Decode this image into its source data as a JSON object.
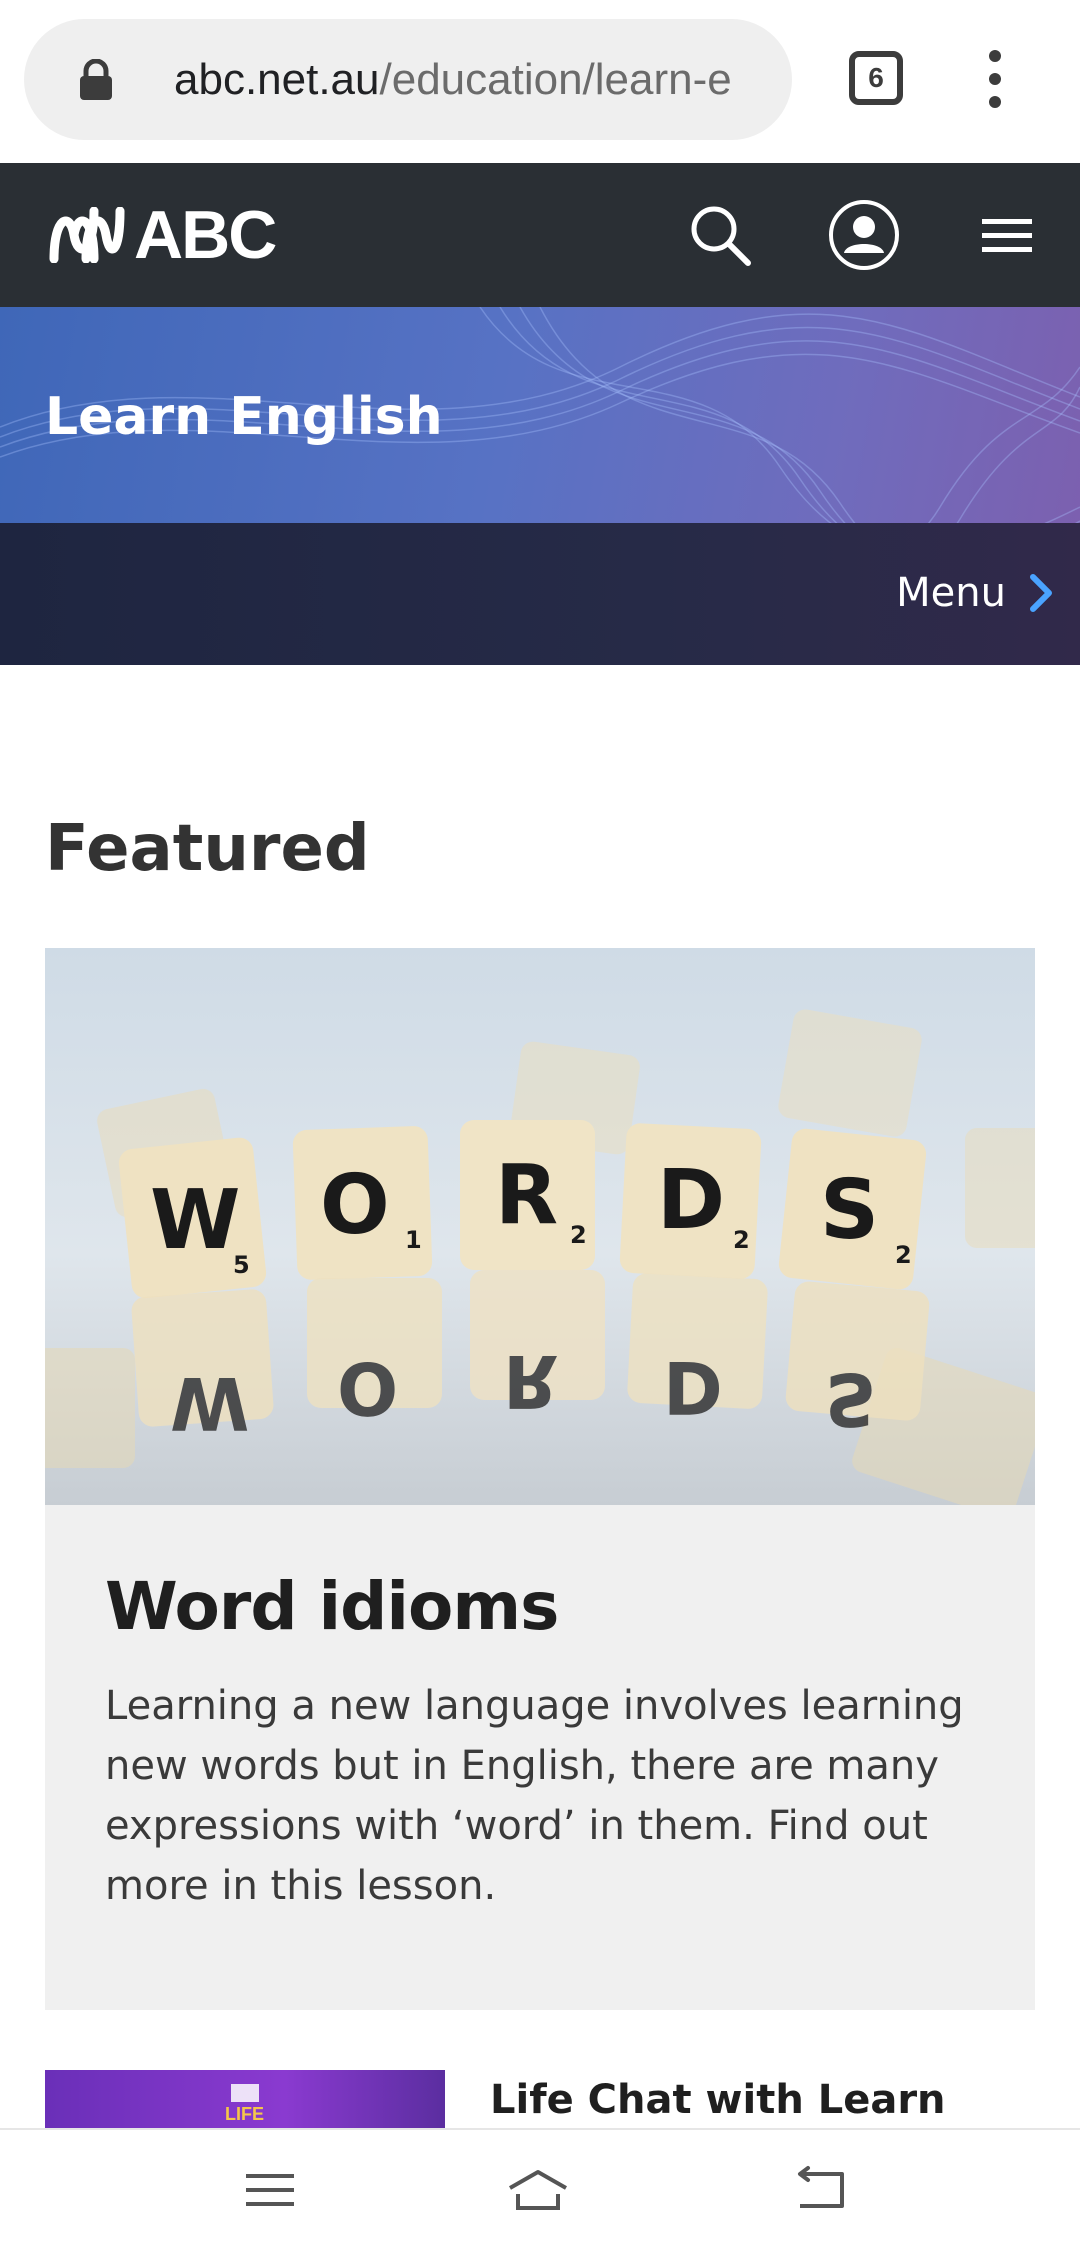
{
  "browser": {
    "url_host": "abc.net.au",
    "url_path": "/education/learn-e",
    "tab_count": "6"
  },
  "header": {
    "logo_text": "ABC"
  },
  "banner": {
    "title": "Learn English",
    "menu_label": "Menu"
  },
  "featured": {
    "heading": "Featured",
    "card": {
      "title": "Word idioms",
      "description": "Learning a new language involves learning new words but in English, there are many expressions with ‘word’ in them. Find out more in this lesson.",
      "image_tiles_top": [
        "W",
        "O",
        "R",
        "D",
        "S"
      ],
      "image_tiles_top_scores": [
        "5",
        "1",
        "2",
        "2",
        "2"
      ]
    }
  },
  "next_item": {
    "title": "Life Chat with Learn",
    "thumb_text": "LIFE"
  },
  "colors": {
    "header_bg": "#2a2f34",
    "banner_start": "#3f67b8",
    "banner_end": "#7d5fae",
    "menu_chevron": "#4aa3ff",
    "card_bg": "#f0f0f0"
  },
  "icons": {
    "lock": "lock-icon",
    "search": "search-icon",
    "account": "account-icon",
    "hamburger": "hamburger-menu-icon",
    "chevron": "chevron-right-icon"
  }
}
